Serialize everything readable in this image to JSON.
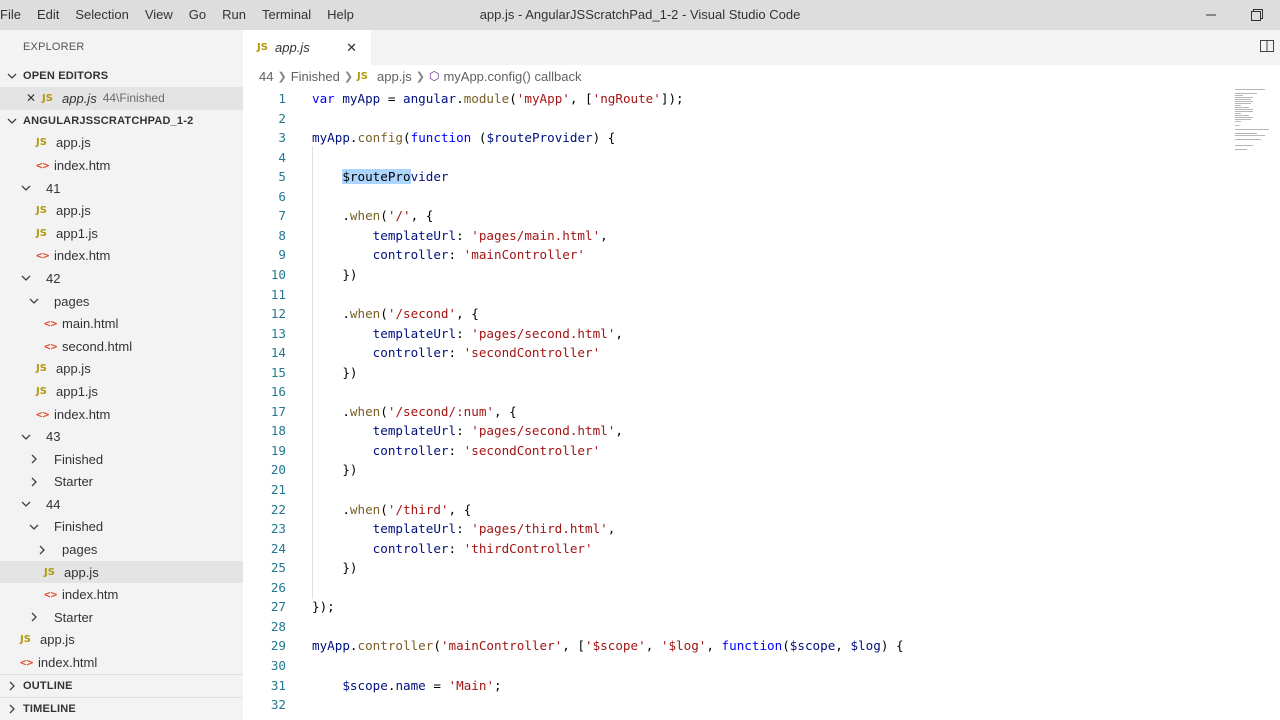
{
  "window": {
    "title": "app.js - AngularJSScratchPad_1-2 - Visual Studio Code",
    "menu": [
      "File",
      "Edit",
      "Selection",
      "View",
      "Go",
      "Run",
      "Terminal",
      "Help"
    ]
  },
  "sidebar": {
    "header": "EXPLORER",
    "open_editors_label": "OPEN EDITORS",
    "open_editor": {
      "icon": "JS",
      "name": "app.js",
      "path": "44\\Finished"
    },
    "project_label": "ANGULARJSSCRATCHPAD_1-2",
    "tree": [
      {
        "label": "app.js",
        "type": "js"
      },
      {
        "label": "index.htm",
        "type": "html"
      },
      {
        "label": "41",
        "type": "folder",
        "open": true
      },
      {
        "label": "app.js",
        "type": "js"
      },
      {
        "label": "app1.js",
        "type": "js"
      },
      {
        "label": "index.htm",
        "type": "html"
      },
      {
        "label": "42",
        "type": "folder",
        "open": true
      },
      {
        "label": "pages",
        "type": "folder",
        "open": true
      },
      {
        "label": "main.html",
        "type": "html"
      },
      {
        "label": "second.html",
        "type": "html"
      },
      {
        "label": "app.js",
        "type": "js"
      },
      {
        "label": "app1.js",
        "type": "js"
      },
      {
        "label": "index.htm",
        "type": "html"
      },
      {
        "label": "43",
        "type": "folder",
        "open": true
      },
      {
        "label": "Finished",
        "type": "folder",
        "open": false
      },
      {
        "label": "Starter",
        "type": "folder",
        "open": false
      },
      {
        "label": "44",
        "type": "folder",
        "open": true
      },
      {
        "label": "Finished",
        "type": "folder",
        "open": true
      },
      {
        "label": "pages",
        "type": "folder",
        "open": false
      },
      {
        "label": "app.js",
        "type": "js",
        "selected": true
      },
      {
        "label": "index.htm",
        "type": "html"
      },
      {
        "label": "Starter",
        "type": "folder",
        "open": false
      },
      {
        "label": "app.js",
        "type": "js"
      },
      {
        "label": "index.html",
        "type": "html"
      }
    ],
    "outline_label": "OUTLINE",
    "timeline_label": "TIMELINE"
  },
  "icons": {
    "js": "JS",
    "html": "<>",
    "close": "✕",
    "chevron_down": "⌄",
    "chevron_right": "›"
  },
  "editor": {
    "tab": {
      "icon": "JS",
      "label": "app.js"
    },
    "breadcrumb": [
      "44",
      "Finished",
      "app.js",
      "myApp.config() callback"
    ],
    "lines": [
      {
        "n": "1",
        "tokens": [
          [
            "kw",
            "var"
          ],
          [
            "p",
            " "
          ],
          [
            "var",
            "myApp"
          ],
          [
            "p",
            " = "
          ],
          [
            "var",
            "angular"
          ],
          [
            "p",
            "."
          ],
          [
            "fn",
            "module"
          ],
          [
            "p",
            "("
          ],
          [
            "str",
            "'myApp'"
          ],
          [
            "p",
            ", ["
          ],
          [
            "str",
            "'ngRoute'"
          ],
          [
            "p",
            "]);"
          ]
        ]
      },
      {
        "n": "2",
        "tokens": []
      },
      {
        "n": "3",
        "tokens": [
          [
            "var",
            "myApp"
          ],
          [
            "p",
            "."
          ],
          [
            "fn",
            "config"
          ],
          [
            "p",
            "("
          ],
          [
            "kw",
            "function"
          ],
          [
            "p",
            " ("
          ],
          [
            "var",
            "$routeProvider"
          ],
          [
            "p",
            ") {"
          ]
        ]
      },
      {
        "n": "4",
        "tokens": []
      },
      {
        "n": "5",
        "tokens": [
          [
            "p",
            "    "
          ],
          [
            "hl",
            "$routePro"
          ],
          [
            "var",
            "vider"
          ]
        ]
      },
      {
        "n": "6",
        "tokens": []
      },
      {
        "n": "7",
        "tokens": [
          [
            "p",
            "    ."
          ],
          [
            "fn",
            "when"
          ],
          [
            "p",
            "("
          ],
          [
            "str",
            "'/'"
          ],
          [
            "p",
            ", {"
          ]
        ]
      },
      {
        "n": "8",
        "tokens": [
          [
            "p",
            "        "
          ],
          [
            "var",
            "templateUrl"
          ],
          [
            "p",
            ": "
          ],
          [
            "str",
            "'pages/main.html'"
          ],
          [
            "p",
            ","
          ]
        ]
      },
      {
        "n": "9",
        "tokens": [
          [
            "p",
            "        "
          ],
          [
            "var",
            "controller"
          ],
          [
            "p",
            ": "
          ],
          [
            "str",
            "'mainController'"
          ]
        ]
      },
      {
        "n": "10",
        "tokens": [
          [
            "p",
            "    })"
          ]
        ]
      },
      {
        "n": "11",
        "tokens": []
      },
      {
        "n": "12",
        "tokens": [
          [
            "p",
            "    ."
          ],
          [
            "fn",
            "when"
          ],
          [
            "p",
            "("
          ],
          [
            "str",
            "'/second'"
          ],
          [
            "p",
            ", {"
          ]
        ]
      },
      {
        "n": "13",
        "tokens": [
          [
            "p",
            "        "
          ],
          [
            "var",
            "templateUrl"
          ],
          [
            "p",
            ": "
          ],
          [
            "str",
            "'pages/second.html'"
          ],
          [
            "p",
            ","
          ]
        ]
      },
      {
        "n": "14",
        "tokens": [
          [
            "p",
            "        "
          ],
          [
            "var",
            "controller"
          ],
          [
            "p",
            ": "
          ],
          [
            "str",
            "'secondController'"
          ]
        ]
      },
      {
        "n": "15",
        "tokens": [
          [
            "p",
            "    })"
          ]
        ]
      },
      {
        "n": "16",
        "tokens": []
      },
      {
        "n": "17",
        "tokens": [
          [
            "p",
            "    ."
          ],
          [
            "fn",
            "when"
          ],
          [
            "p",
            "("
          ],
          [
            "str",
            "'/second/:num'"
          ],
          [
            "p",
            ", {"
          ]
        ]
      },
      {
        "n": "18",
        "tokens": [
          [
            "p",
            "        "
          ],
          [
            "var",
            "templateUrl"
          ],
          [
            "p",
            ": "
          ],
          [
            "str",
            "'pages/second.html'"
          ],
          [
            "p",
            ","
          ]
        ]
      },
      {
        "n": "19",
        "tokens": [
          [
            "p",
            "        "
          ],
          [
            "var",
            "controller"
          ],
          [
            "p",
            ": "
          ],
          [
            "str",
            "'secondController'"
          ]
        ]
      },
      {
        "n": "20",
        "tokens": [
          [
            "p",
            "    })"
          ]
        ]
      },
      {
        "n": "21",
        "tokens": []
      },
      {
        "n": "22",
        "tokens": [
          [
            "p",
            "    ."
          ],
          [
            "fn",
            "when"
          ],
          [
            "p",
            "("
          ],
          [
            "str",
            "'/third'"
          ],
          [
            "p",
            ", {"
          ]
        ]
      },
      {
        "n": "23",
        "tokens": [
          [
            "p",
            "        "
          ],
          [
            "var",
            "templateUrl"
          ],
          [
            "p",
            ": "
          ],
          [
            "str",
            "'pages/third.html'"
          ],
          [
            "p",
            ","
          ]
        ]
      },
      {
        "n": "24",
        "tokens": [
          [
            "p",
            "        "
          ],
          [
            "var",
            "controller"
          ],
          [
            "p",
            ": "
          ],
          [
            "str",
            "'thirdController'"
          ]
        ]
      },
      {
        "n": "25",
        "tokens": [
          [
            "p",
            "    })"
          ]
        ]
      },
      {
        "n": "26",
        "tokens": []
      },
      {
        "n": "27",
        "tokens": [
          [
            "p",
            "});"
          ]
        ]
      },
      {
        "n": "28",
        "tokens": []
      },
      {
        "n": "29",
        "tokens": [
          [
            "var",
            "myApp"
          ],
          [
            "p",
            "."
          ],
          [
            "fn",
            "controller"
          ],
          [
            "p",
            "("
          ],
          [
            "str",
            "'mainController'"
          ],
          [
            "p",
            ", ["
          ],
          [
            "str",
            "'$scope'"
          ],
          [
            "p",
            ", "
          ],
          [
            "str",
            "'$log'"
          ],
          [
            "p",
            ", "
          ],
          [
            "kw",
            "function"
          ],
          [
            "p",
            "("
          ],
          [
            "var",
            "$scope"
          ],
          [
            "p",
            ", "
          ],
          [
            "var",
            "$log"
          ],
          [
            "p",
            ") {"
          ]
        ]
      },
      {
        "n": "30",
        "tokens": []
      },
      {
        "n": "31",
        "tokens": [
          [
            "p",
            "    "
          ],
          [
            "var",
            "$scope"
          ],
          [
            "p",
            "."
          ],
          [
            "var",
            "name"
          ],
          [
            "p",
            " = "
          ],
          [
            "str",
            "'Main'"
          ],
          [
            "p",
            ";"
          ]
        ]
      },
      {
        "n": "32",
        "tokens": []
      }
    ]
  }
}
